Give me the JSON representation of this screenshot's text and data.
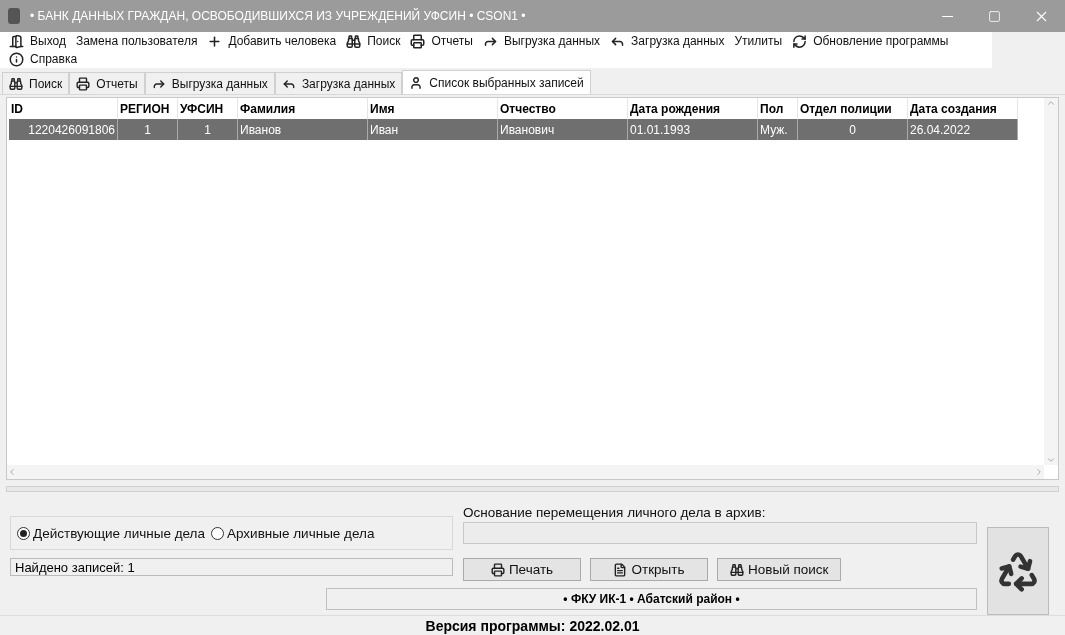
{
  "window": {
    "title": "• БАНК ДАННЫХ ГРАЖДАН, ОСВОБОДИВШИХСЯ ИЗ УЧРЕЖДЕНИЙ УФСИН • CSON1 •"
  },
  "menu": [
    "Выход",
    "Замена пользователя",
    "Добавить человека",
    "Поиск",
    "Отчеты",
    "Выгрузка данных",
    "Загрузка данных",
    "Утилиты",
    "Обновление программы",
    "Справка"
  ],
  "tabs": [
    {
      "label": "Поиск",
      "selected": false
    },
    {
      "label": "Отчеты",
      "selected": false
    },
    {
      "label": "Выгрузка данных",
      "selected": false
    },
    {
      "label": "Загрузка данных",
      "selected": false
    },
    {
      "label": "Список выбранных записей",
      "selected": true
    }
  ],
  "table": {
    "columns": [
      "ID",
      "РЕГИОН",
      "УФСИН",
      "Фамилия",
      "Имя",
      "Отчество",
      "Дата рождения",
      "Пол",
      "Отдел полиции",
      "Дата создания"
    ],
    "rows": [
      {
        "selected": true,
        "cells": [
          "1220426091806",
          "1",
          "1",
          "Иванов",
          "Иван",
          "Иванович",
          "01.01.1993",
          "Муж.",
          "0",
          "26.04.2022"
        ]
      }
    ]
  },
  "filter": [
    {
      "label": "Действующие личные дела",
      "selected": true
    },
    {
      "label": "Архивные личные дела",
      "selected": false
    }
  ],
  "found": "Найдено записей: 1",
  "archive_reason": {
    "label": "Основание перемещения личного дела в архив:"
  },
  "buttons": [
    "Печать",
    "Открыть",
    "Новый поиск"
  ],
  "info_bar": "• ФКУ ИК-1 • Абатский район •",
  "status_bar": "Версия программы: 2022.02.01"
}
